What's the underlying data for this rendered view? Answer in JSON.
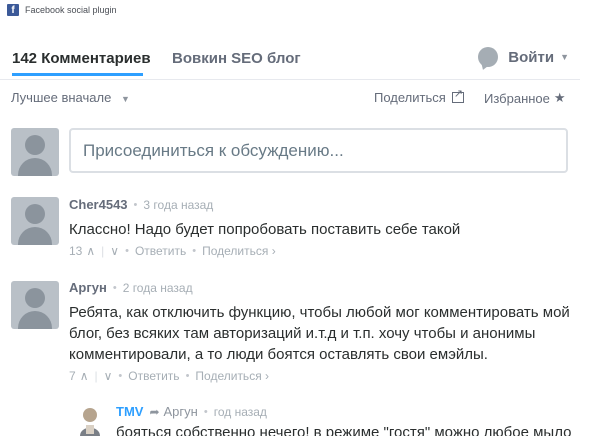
{
  "plugin": {
    "label": "Facebook social plugin"
  },
  "tabs": {
    "count_label": "142 Комментариев",
    "forum_label": "Вовкин SEO блог",
    "login_label": "Войти"
  },
  "toolbar": {
    "sort_label": "Лучшее вначале",
    "share_label": "Поделиться",
    "fav_label": "Избранное"
  },
  "input": {
    "placeholder": "Присоединиться к обсуждению..."
  },
  "comments": [
    {
      "author": "Cher4543",
      "time": "3 года назад",
      "lines": [
        "Классно! Надо будет попробовать поставить себе такой"
      ],
      "votes": "13",
      "reply_label": "Ответить",
      "share_label": "Поделиться ›"
    },
    {
      "author": "Аргун",
      "time": "2 года назад",
      "lines": [
        "Ребята, как отключить функцию, чтобы любой мог комментировать мой",
        "блог, без всяких там авторизаций и.т.д и т.п. хочу чтобы и анонимы",
        "комментировали, а то люди боятся оставлять свои емэйлы."
      ],
      "votes": "7",
      "reply_label": "Ответить",
      "share_label": "Поделиться ›"
    }
  ],
  "reply": {
    "author": "TMV",
    "reply_to": "Аргун",
    "time": "год назад",
    "text": "бояться собственно нечего! в режиме \"гостя\" можно любое мыло"
  },
  "colors": {
    "accent": "#2e9fff",
    "facebook": "#3b5998",
    "muted": "#656c7a"
  }
}
